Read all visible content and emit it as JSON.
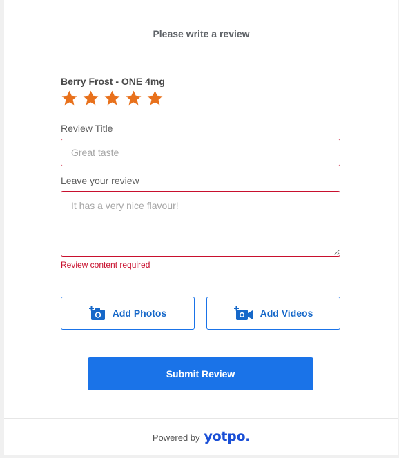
{
  "form": {
    "heading": "Please write a review",
    "product_name": "Berry Frost - ONE 4mg",
    "rating": {
      "value": 5,
      "max": 5,
      "color": "#e8711c"
    },
    "title_label": "Review Title",
    "title_placeholder": "Great taste",
    "review_label": "Leave your review",
    "review_placeholder": "It has a very nice flavour!",
    "error_message": "Review content required",
    "add_photos_label": "Add Photos",
    "add_videos_label": "Add Videos",
    "submit_label": "Submit Review",
    "accent_color": "#1a73e8",
    "error_color": "#c8102e"
  },
  "footer": {
    "powered_by": "Powered by",
    "brand": "yotpo."
  }
}
